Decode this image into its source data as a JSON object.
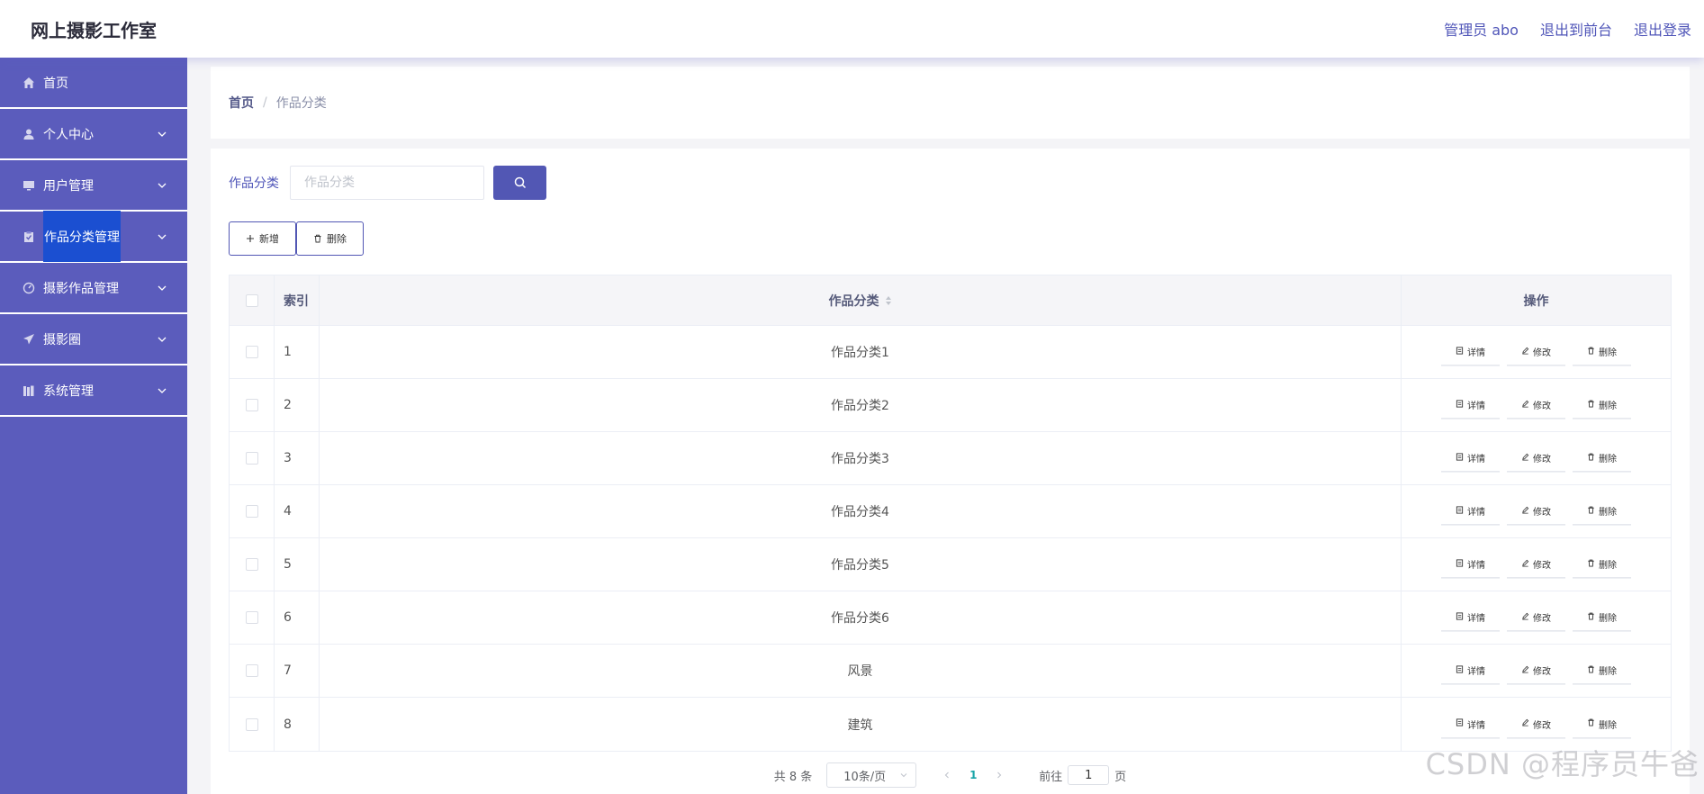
{
  "app": {
    "title": "网上摄影工作室"
  },
  "header": {
    "links": [
      "管理员 abo",
      "退出到前台",
      "退出登录"
    ]
  },
  "sidebar": {
    "items": [
      {
        "label": "首页",
        "icon": "home-icon"
      },
      {
        "label": "个人中心",
        "icon": "user-icon"
      },
      {
        "label": "用户管理",
        "icon": "monitor-icon"
      },
      {
        "label": "作品分类管理",
        "icon": "clipboard-icon",
        "active": true
      },
      {
        "label": "摄影作品管理",
        "icon": "gauge-icon"
      },
      {
        "label": "摄影圈",
        "icon": "paper-plane-icon"
      },
      {
        "label": "系统管理",
        "icon": "books-icon"
      }
    ]
  },
  "breadcrumb": {
    "home": "首页",
    "separator": "/",
    "current": "作品分类"
  },
  "search": {
    "label": "作品分类",
    "placeholder": "作品分类",
    "value": ""
  },
  "actions": {
    "add_label": "新增",
    "delete_label": "删除"
  },
  "table": {
    "headers": {
      "index": "索引",
      "category": "作品分类",
      "ops": "操作"
    },
    "op_labels": {
      "detail": "详情",
      "edit": "修改",
      "delete": "删除"
    },
    "rows": [
      {
        "index": "1",
        "category": "作品分类1"
      },
      {
        "index": "2",
        "category": "作品分类2"
      },
      {
        "index": "3",
        "category": "作品分类3"
      },
      {
        "index": "4",
        "category": "作品分类4"
      },
      {
        "index": "5",
        "category": "作品分类5"
      },
      {
        "index": "6",
        "category": "作品分类6"
      },
      {
        "index": "7",
        "category": "风景"
      },
      {
        "index": "8",
        "category": "建筑"
      }
    ]
  },
  "pagination": {
    "total": "共 8 条",
    "page_size": "10条/页",
    "current_page": "1",
    "goto_prefix": "前往",
    "goto_value": "1",
    "goto_suffix": "页"
  },
  "watermark": "CSDN @程序员牛爸",
  "colors": {
    "sidebar": "#5b5cbc",
    "accent": "#5257b4",
    "active": "#1b4fd1",
    "page_active": "#1aa5a8"
  }
}
